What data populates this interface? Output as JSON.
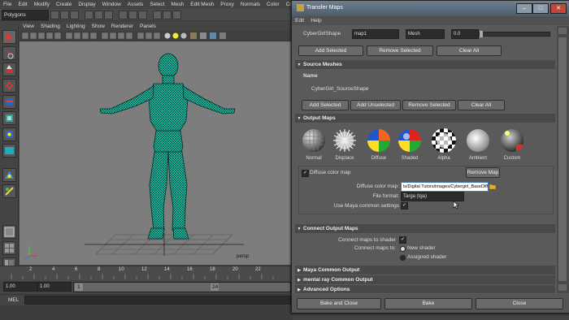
{
  "main_menu": [
    "File",
    "Edit",
    "Modify",
    "Create",
    "Display",
    "Window",
    "Assets",
    "Select",
    "Mesh",
    "Edit Mesh",
    "Proxy",
    "Normals",
    "Color",
    "Create UV"
  ],
  "mode_selector": "Polygons",
  "viewport": {
    "menu": [
      "View",
      "Shading",
      "Lighting",
      "Show",
      "Renderer",
      "Panels"
    ],
    "camera_label": "persp"
  },
  "timeline": {
    "ticks": [
      "2",
      "4",
      "6",
      "8",
      "10",
      "12",
      "14",
      "16",
      "18",
      "20",
      "22"
    ],
    "range_start": "1.00",
    "playback_start": "1.00",
    "current_frame": "1",
    "range_end_marker": "24"
  },
  "command_line": {
    "label": "MEL"
  },
  "transfer_maps": {
    "title": "Transfer Maps",
    "menu": [
      "Edit",
      "Help"
    ],
    "target": {
      "name": "CyberGirlShape",
      "map_select": "map1",
      "display_select": "Mesh",
      "envelope": "0.0"
    },
    "target_buttons": {
      "add": "Add Selected",
      "remove": "Remove Selected",
      "clear": "Clear All"
    },
    "source_meshes": {
      "header": "Source Meshes",
      "column": "Name",
      "items": [
        "CyberGirl_SourceShape"
      ],
      "buttons": {
        "add": "Add Selected",
        "add_unselected": "Add Unselected",
        "remove": "Remove Selected",
        "clear": "Clear All"
      }
    },
    "output_maps": {
      "header": "Output Maps",
      "types": [
        "Normal",
        "Displace",
        "Diffuse",
        "Shaded",
        "Alpha",
        "Ambient",
        "Custom"
      ],
      "diffuse": {
        "enabled_label": "Diffuse color map",
        "remove_label": "Remove Map",
        "path_label": "Diffuse color map:",
        "path_value": "ls/Digital Tutors/images/Cybergirl_BaseDiffuse.tga",
        "format_label": "File format:",
        "format_value": "Targa (tga)",
        "common_label": "Use Maya common settings"
      }
    },
    "connect_output": {
      "header": "Connect Output Maps",
      "connect_label": "Connect maps to shader",
      "connect_to_label": "Connect maps to:",
      "options": [
        "New shader",
        "Assigned shader"
      ]
    },
    "collapsed_sections": [
      "Maya Common Output",
      "mental ray Common Output",
      "Advanced Options"
    ],
    "bottom_buttons": {
      "bake_close": "Bake and Close",
      "bake": "Bake",
      "close": "Close"
    }
  }
}
